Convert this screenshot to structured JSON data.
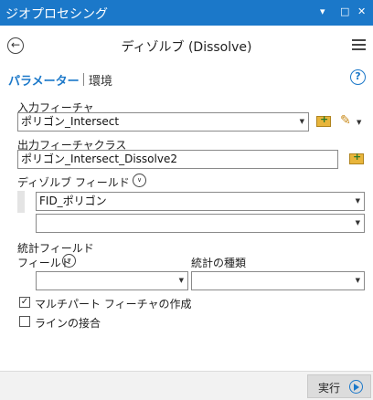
{
  "pane": {
    "title": "ジオプロセシング",
    "pin_symbol": "▾",
    "restore_symbol": "□",
    "close_symbol": "✕"
  },
  "header": {
    "back_symbol": "←",
    "tool_title": "ディゾルブ (Dissolve)"
  },
  "tabs": {
    "parameters": "パラメーター",
    "environments": "環境",
    "help_symbol": "?"
  },
  "params": {
    "input_label": "入力フィーチャ",
    "input_value": "ポリゴン_Intersect",
    "output_label": "出力フィーチャクラス",
    "output_value": "ポリゴン_Intersect_Dissolve2",
    "dissolve_field_label": "ディゾルブ フィールド",
    "dissolve_fields": [
      "FID_ポリゴン",
      ""
    ],
    "stats_label": "統計フィールド",
    "field_label": "フィールド",
    "stat_type_label": "統計の種類",
    "stats_field_value": "",
    "stats_type_value": "",
    "multipart_label": "マルチパート フィーチャの作成",
    "multipart_checked": true,
    "unsplit_label": "ラインの接合",
    "unsplit_checked": false
  },
  "footer": {
    "run_label": "実行"
  },
  "icons": {
    "dropdown": "▼",
    "chevron_down": "∨",
    "check": "✓",
    "pencil": "✎",
    "plus": "+"
  },
  "colors": {
    "accent": "#1b78c9",
    "titlebar": "#1b78c9",
    "folder": "#e8b53b"
  }
}
